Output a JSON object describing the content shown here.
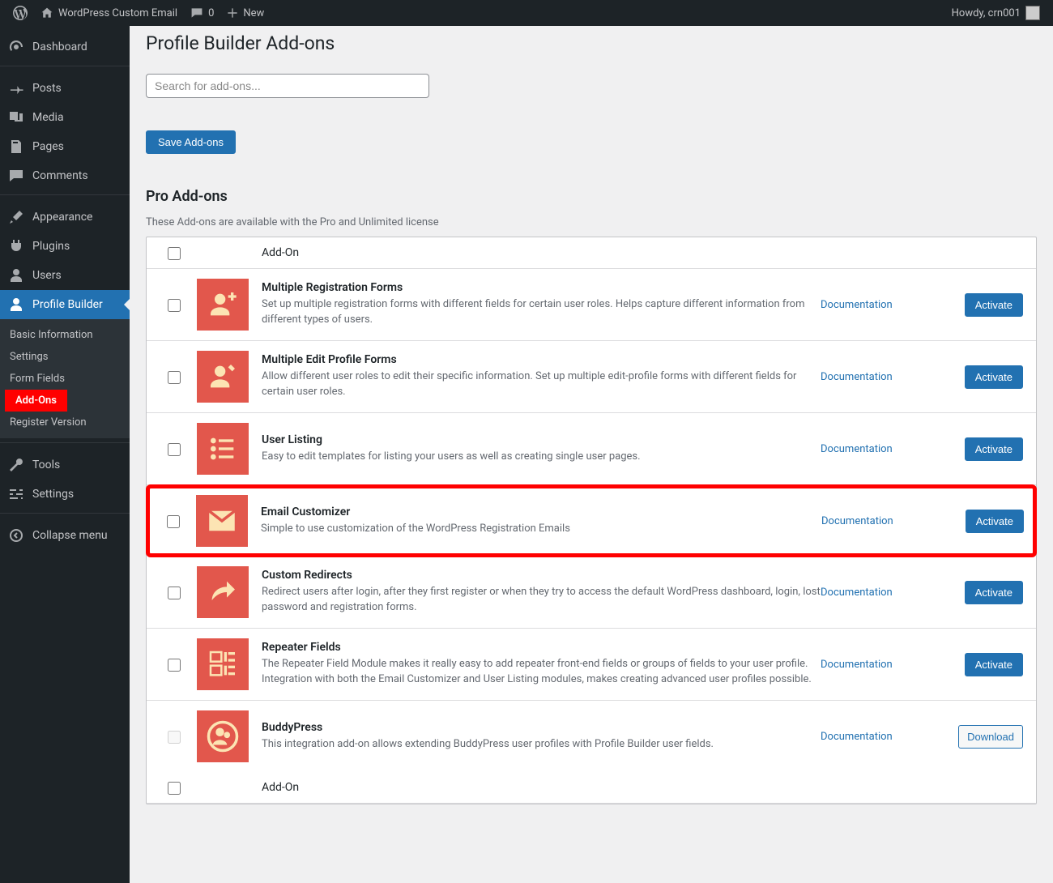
{
  "adminbar": {
    "site_title": "WordPress Custom Email",
    "comments_count": "0",
    "new_label": "New",
    "howdy": "Howdy, crn001"
  },
  "sidebar": {
    "items": [
      {
        "label": "Dashboard"
      },
      {
        "label": "Posts"
      },
      {
        "label": "Media"
      },
      {
        "label": "Pages"
      },
      {
        "label": "Comments"
      },
      {
        "label": "Appearance"
      },
      {
        "label": "Plugins"
      },
      {
        "label": "Users"
      },
      {
        "label": "Profile Builder"
      },
      {
        "label": "Tools"
      },
      {
        "label": "Settings"
      },
      {
        "label": "Collapse menu"
      }
    ],
    "submenu": [
      {
        "label": "Basic Information"
      },
      {
        "label": "Settings"
      },
      {
        "label": "Form Fields"
      },
      {
        "label": "Add-Ons"
      },
      {
        "label": "Register Version"
      }
    ]
  },
  "page": {
    "title": "Profile Builder Add-ons",
    "search_placeholder": "Search for add-ons...",
    "save_button": "Save Add-ons",
    "section_title": "Pro Add-ons",
    "section_desc": "These Add-ons are available with the Pro and Unlimited license",
    "header_addon": "Add-On",
    "doc_label": "Documentation",
    "activate_label": "Activate",
    "download_label": "Download",
    "addons": [
      {
        "name": "Multiple Registration Forms",
        "desc": "Set up multiple registration forms with different fields for certain user roles. Helps capture different information from different types of users.",
        "icon": "user-plus",
        "action": "activate",
        "checkable": true
      },
      {
        "name": "Multiple Edit Profile Forms",
        "desc": "Allow different user roles to edit their specific information. Set up multiple edit-profile forms with different fields for certain user roles.",
        "icon": "user-edit",
        "action": "activate",
        "checkable": true
      },
      {
        "name": "User Listing",
        "desc": "Easy to edit templates for listing your users as well as creating single user pages.",
        "icon": "list",
        "action": "activate",
        "checkable": true
      },
      {
        "name": "Email Customizer",
        "desc": "Simple to use customization of the WordPress Registration Emails",
        "icon": "email",
        "action": "activate",
        "checkable": true,
        "highlight": true
      },
      {
        "name": "Custom Redirects",
        "desc": "Redirect users after login, after they first register or when they try to access the default WordPress dashboard, login, lost password and registration forms.",
        "icon": "redirect",
        "action": "activate",
        "checkable": true
      },
      {
        "name": "Repeater Fields",
        "desc": "The Repeater Field Module makes it really easy to add repeater front-end fields or groups of fields to your user profile. Integration with both the Email Customizer and User Listing modules, makes creating advanced user profiles possible.",
        "icon": "repeater",
        "action": "activate",
        "checkable": true
      },
      {
        "name": "BuddyPress",
        "desc": "This integration add-on allows extending BuddyPress user profiles with Profile Builder user fields.",
        "icon": "buddy",
        "action": "download",
        "checkable": false
      }
    ]
  }
}
